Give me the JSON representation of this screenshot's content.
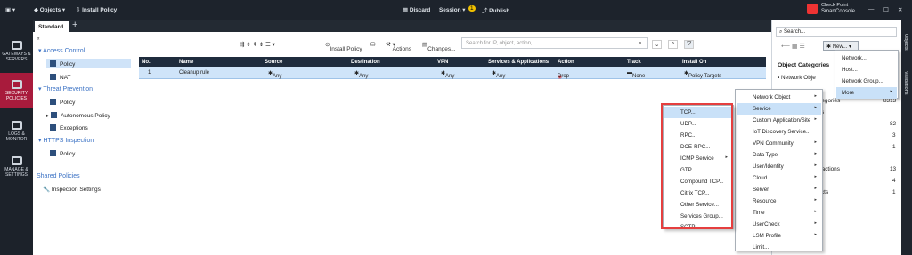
{
  "topbar": {
    "objects": "Objects",
    "install_policy": "Install Policy",
    "discard": "Discard",
    "session": "Session",
    "badge": "1",
    "publish": "Publish",
    "brand_top": "Check Point",
    "brand_bottom": "SmartConsole"
  },
  "leftnav": [
    {
      "label": "GATEWAYS & SERVERS"
    },
    {
      "label": "SECURITY POLICIES"
    },
    {
      "label": "LOGS & MONITOR"
    },
    {
      "label": "MANAGE & SETTINGS"
    }
  ],
  "tabs": {
    "active": "Standard",
    "add": "+"
  },
  "tree": {
    "access_control": "Access Control",
    "policy": "Policy",
    "nat": "NAT",
    "threat_prevention": "Threat Prevention",
    "tp_policy": "Policy",
    "autonomous_policy": "Autonomous Policy",
    "exceptions": "Exceptions",
    "https_inspection": "HTTPS Inspection",
    "https_policy": "Policy",
    "shared_policies": "Shared Policies",
    "inspection_settings": "Inspection Settings"
  },
  "toolbar": {
    "install_policy": "Install Policy",
    "actions": "Actions",
    "changes": "Changes...",
    "search_placeholder": "Search for IP, object, action, ..."
  },
  "table": {
    "headers": [
      "No.",
      "Name",
      "Source",
      "Destination",
      "VPN",
      "Services & Applications",
      "Action",
      "Track",
      "Install On"
    ],
    "row": [
      "1",
      "Cleanup rule",
      "Any",
      "Any",
      "Any",
      "Any",
      "Drop",
      "None",
      "Policy Targets"
    ]
  },
  "panel": {
    "search": "Search...",
    "new": "New...",
    "categories_title": "Object Categories",
    "network_objects": "Network Obje",
    "counts": [
      "8313",
      "",
      "82",
      "",
      "3",
      "1",
      "",
      "13",
      "4",
      "1"
    ],
    "partials": [
      "ategories",
      "ies",
      "",
      "n",
      "",
      "",
      "eractions",
      "",
      "jects"
    ]
  },
  "new_menu": [
    "Network...",
    "Host...",
    "Network Group...",
    "More"
  ],
  "more_menu": [
    "Network Object",
    "Service",
    "Custom Application/Site",
    "IoT Discovery Service...",
    "VPN Community",
    "Data Type",
    "User/Identity",
    "Cloud",
    "Server",
    "Resource",
    "Time",
    "UserCheck",
    "LSM Profile",
    "Limit..."
  ],
  "service_menu": [
    "TCP...",
    "UDP...",
    "RPC...",
    "DCE-RPC...",
    "ICMP Service",
    "GTP...",
    "Compound TCP...",
    "Citrix TCP...",
    "Other Service...",
    "Services Group...",
    "SCTP..."
  ],
  "right_strip": {
    "objects": "Objects",
    "validations": "Validations"
  }
}
